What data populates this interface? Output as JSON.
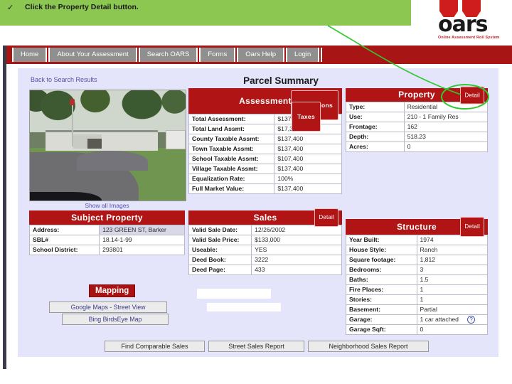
{
  "banner": {
    "bullet_icon": "checkmark-icon",
    "text": "Click the Property Detail button."
  },
  "logo": {
    "wordmark": "oars",
    "tagline": "Online Assessment Roll System"
  },
  "nav": {
    "items": [
      {
        "label": "Home"
      },
      {
        "label": "About Your Assessment"
      },
      {
        "label": "Search OARS"
      },
      {
        "label": "Forms"
      },
      {
        "label": "Oars Help"
      },
      {
        "label": "Login"
      }
    ]
  },
  "page": {
    "back_link": "Back to Search Results",
    "title": "Parcel Summary",
    "show_all_images": "Show all Images"
  },
  "assessment": {
    "title": "Assessment",
    "exemptions_button": "Exemptions",
    "taxes_button": "Taxes",
    "rows": [
      {
        "key": "Total Assessment:",
        "value": "$137,400"
      },
      {
        "key": "Total Land Assmt:",
        "value": "$17,300"
      },
      {
        "key": "County Taxable Assmt:",
        "value": "$137,400"
      },
      {
        "key": "Town Taxable Assmt:",
        "value": "$137,400"
      },
      {
        "key": "School Taxable Assmt:",
        "value": "$107,400"
      },
      {
        "key": "Village Taxable Assmt:",
        "value": "$137,400"
      },
      {
        "key": "Equalization Rate:",
        "value": "100%"
      },
      {
        "key": "Full Market Value:",
        "value": "$137,400"
      }
    ]
  },
  "property": {
    "title": "Property",
    "detail_button": "Detail",
    "rows": [
      {
        "key": "Type:",
        "value": "Residential"
      },
      {
        "key": "Use:",
        "value": "210 - 1 Family Res"
      },
      {
        "key": "Frontage:",
        "value": "162"
      },
      {
        "key": "Depth:",
        "value": "518.23"
      },
      {
        "key": "Acres:",
        "value": "0"
      }
    ]
  },
  "subject_property": {
    "title": "Subject Property",
    "rows": [
      {
        "key": "Address:",
        "value": "123 GREEN ST, Barker"
      },
      {
        "key": "SBL#",
        "value": "18.14-1-99"
      },
      {
        "key": "School District:",
        "value": "293801"
      }
    ]
  },
  "sales": {
    "title": "Sales",
    "detail_button": "Detail",
    "rows": [
      {
        "key": "Valid Sale Date:",
        "value": "12/26/2002"
      },
      {
        "key": "Valid Sale Price:",
        "value": "$133,000"
      },
      {
        "key": "Useable:",
        "value": "YES"
      },
      {
        "key": "Deed Book:",
        "value": "3222"
      },
      {
        "key": "Deed Page:",
        "value": "433"
      }
    ]
  },
  "structure": {
    "title": "Structure",
    "detail_button": "Detail",
    "rows": [
      {
        "key": "Year Built:",
        "value": "1974"
      },
      {
        "key": "House Style:",
        "value": "Ranch"
      },
      {
        "key": "Square footage:",
        "value": "1,812"
      },
      {
        "key": "Bedrooms:",
        "value": "3"
      },
      {
        "key": "Baths:",
        "value": "1.5"
      },
      {
        "key": "Fire Places:",
        "value": "1"
      },
      {
        "key": "Stories:",
        "value": "1"
      },
      {
        "key": "Basement:",
        "value": "Partial"
      },
      {
        "key": "Garage:",
        "value": "1 car attached",
        "help_icon": "question-mark-icon"
      },
      {
        "key": "Garage Sqft:",
        "value": "0"
      }
    ]
  },
  "mapping": {
    "badge": "Mapping",
    "google_maps_button": "Google Maps - Street View",
    "bing_button": "Bing BirdsEye Map"
  },
  "bottom_buttons": [
    {
      "label": "Find Comparable Sales"
    },
    {
      "label": "Street Sales Report"
    },
    {
      "label": "Neighborhood Sales Report"
    }
  ],
  "annotation": {
    "highlight_shape": "ellipse-around-property-detail-button",
    "pointer_color": "#28c828"
  },
  "colors": {
    "banner_green": "#8cc751",
    "brand_red": "#b01414",
    "nav_red": "#a81515",
    "page_bg": "#e4e4fb",
    "annotation_green": "#28c828"
  }
}
